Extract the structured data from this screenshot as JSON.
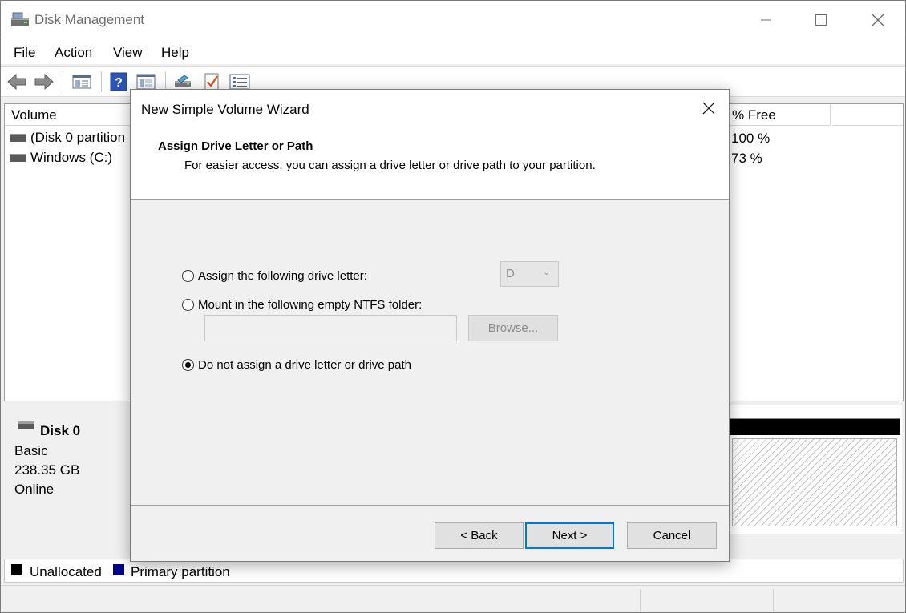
{
  "window": {
    "title": "Disk Management",
    "controls": {
      "minimize": "—",
      "maximize": "☐",
      "close": "✕"
    }
  },
  "menu": [
    "File",
    "Action",
    "View",
    "Help"
  ],
  "toolbar_icons": [
    "back-arrow-icon",
    "forward-arrow-icon",
    "show-hide-console-tree-icon",
    "help-icon",
    "properties-icon",
    "connect-disk-icon",
    "check-icon",
    "list-icon"
  ],
  "volume_list": {
    "columns": {
      "volume": "Volume",
      "free_pct": "% Free"
    },
    "rows": [
      {
        "name": "(Disk 0 partition",
        "free": "100 %"
      },
      {
        "name": "Windows (C:)",
        "free": "73 %"
      }
    ]
  },
  "disk": {
    "name": "Disk 0",
    "type": "Basic",
    "size": "238.35 GB",
    "status": "Online"
  },
  "legend": [
    {
      "label": "Unallocated",
      "color": "#000000"
    },
    {
      "label": "Primary partition",
      "color": "#00008b"
    }
  ],
  "dialog": {
    "title": "New Simple Volume Wizard",
    "close": "✕",
    "heading": "Assign Drive Letter or Path",
    "subheading": "For easier access, you can assign a drive letter or drive path to your partition.",
    "options": {
      "assign_letter": "Assign the following drive letter:",
      "mount_folder": "Mount in the following empty NTFS folder:",
      "no_assign": "Do not assign a drive letter or drive path"
    },
    "selected_option": "no_assign",
    "drive_letter": "D",
    "ntfs_path": "",
    "browse_label": "Browse...",
    "buttons": {
      "back": "< Back",
      "next": "Next >",
      "cancel": "Cancel"
    }
  }
}
